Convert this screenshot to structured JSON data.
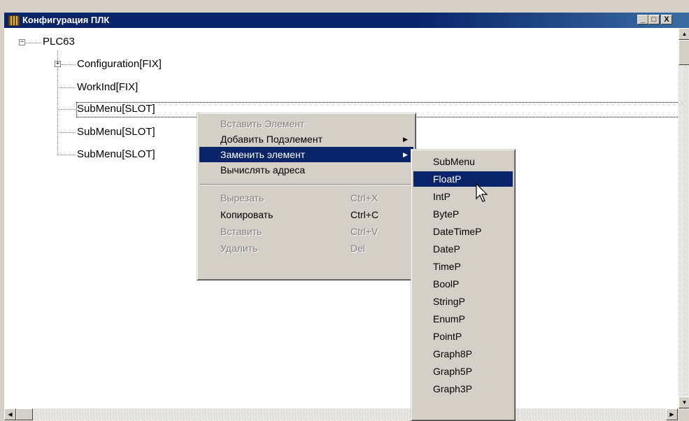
{
  "window": {
    "title": "Конфигурация ПЛК",
    "minimize_glyph": "_",
    "maximize_glyph": "□",
    "close_glyph": "X"
  },
  "tree": {
    "root": "PLC63",
    "nodes": [
      "Configuration[FIX]",
      "WorkInd[FIX]",
      "SubMenu[SLOT]",
      "SubMenu[SLOT]",
      "SubMenu[SLOT]"
    ],
    "collapse_glyph": "−",
    "expand_glyph": "+"
  },
  "context_menu": {
    "items": [
      {
        "label": "Вставить Элемент",
        "shortcut": ""
      },
      {
        "label": "Добавить Подэлемент",
        "shortcut": ""
      },
      {
        "label": "Заменить элемент",
        "shortcut": ""
      },
      {
        "label": "Вычислять адреса",
        "shortcut": ""
      },
      {
        "label": "Вырезать",
        "shortcut": "Ctrl+X"
      },
      {
        "label": "Копировать",
        "shortcut": "Ctrl+C"
      },
      {
        "label": "Вставить",
        "shortcut": "Ctrl+V"
      },
      {
        "label": "Удалить",
        "shortcut": "Del"
      }
    ],
    "arrow_glyph": "▶"
  },
  "submenu": {
    "items": [
      "SubMenu",
      "FloatP",
      "IntP",
      "ByteP",
      "DateTimeP",
      "DateP",
      "TimeP",
      "BoolP",
      "StringP",
      "EnumP",
      "PointP",
      "Graph8P",
      "Graph5P",
      "Graph3P"
    ]
  },
  "scroll": {
    "up": "▲",
    "down": "▼",
    "left": "◀",
    "right": "▶"
  },
  "colors": {
    "titlebar": "#0a246a",
    "highlight": "#0a246a",
    "face": "#d4d0c8"
  }
}
